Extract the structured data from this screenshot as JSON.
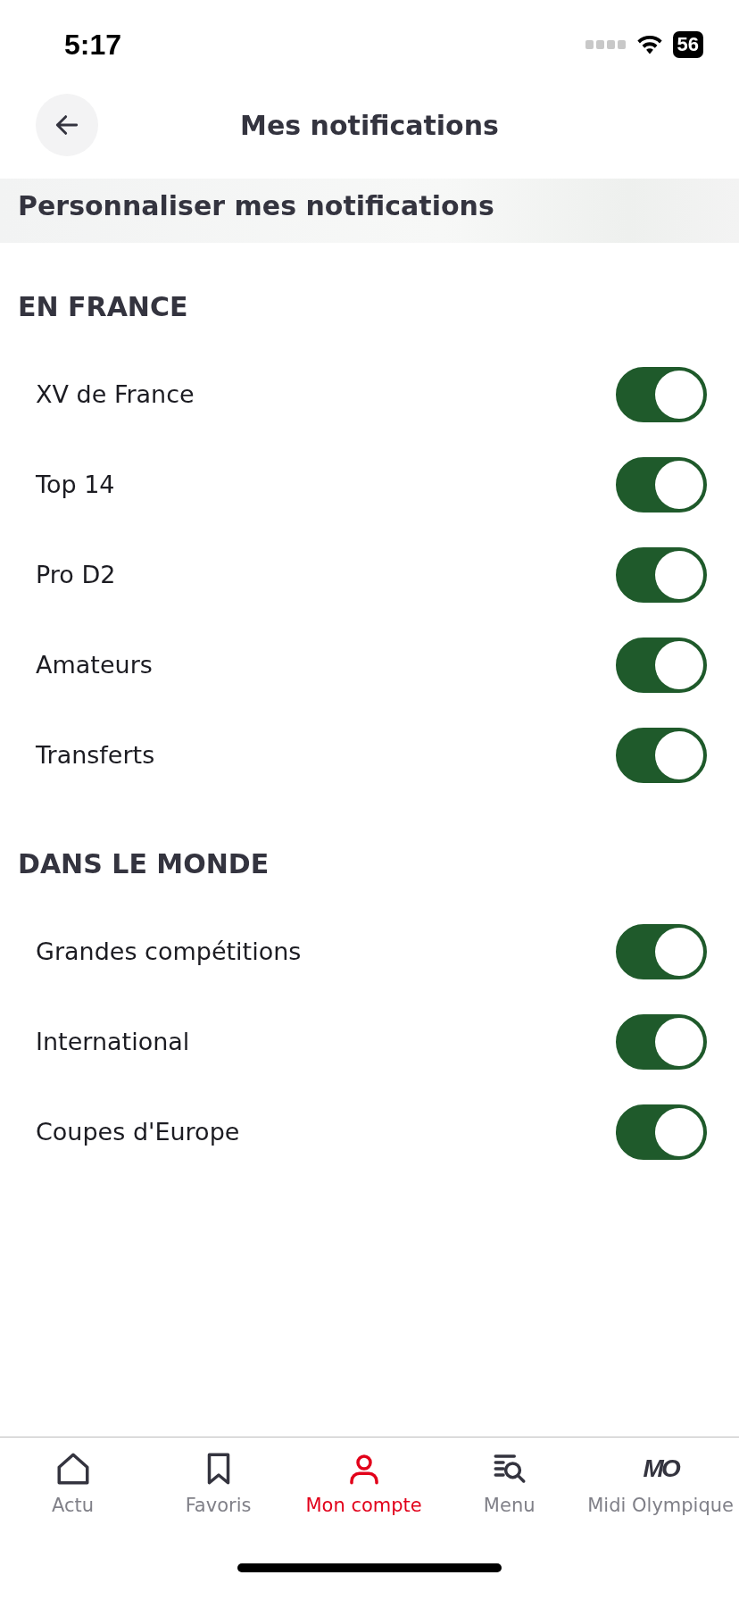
{
  "status_bar": {
    "time": "5:17",
    "battery": "56"
  },
  "header": {
    "title": "Mes notifications"
  },
  "banner": {
    "title": "Personnaliser mes notifications"
  },
  "sections": [
    {
      "title": "EN FRANCE",
      "items": [
        {
          "label": "XV de France",
          "on": true
        },
        {
          "label": "Top 14",
          "on": true
        },
        {
          "label": "Pro D2",
          "on": true
        },
        {
          "label": "Amateurs",
          "on": true
        },
        {
          "label": "Transferts",
          "on": true
        }
      ]
    },
    {
      "title": "DANS LE MONDE",
      "items": [
        {
          "label": "Grandes compétitions",
          "on": true
        },
        {
          "label": "International",
          "on": true
        },
        {
          "label": "Coupes d'Europe",
          "on": true
        }
      ]
    }
  ],
  "tab_bar": [
    {
      "kind": "home",
      "label": "Actu",
      "selected": false
    },
    {
      "kind": "bookmark",
      "label": "Favoris",
      "selected": false
    },
    {
      "kind": "person",
      "label": "Mon compte",
      "selected": true
    },
    {
      "kind": "search",
      "label": "Menu",
      "selected": false
    },
    {
      "kind": "logo",
      "logo": "MO",
      "label": "Midi Olympique",
      "selected": false
    }
  ]
}
